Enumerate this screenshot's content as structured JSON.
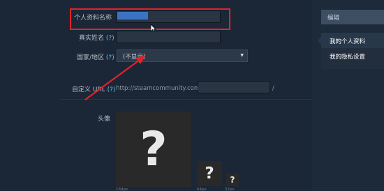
{
  "sidebar": {
    "edit_label": "编辑",
    "items": [
      {
        "label": "我的个人资料",
        "active": true
      },
      {
        "label": "我的隐私设置",
        "active": false
      }
    ]
  },
  "form": {
    "profile_name": {
      "label": "个人资料名称"
    },
    "real_name": {
      "label": "真实姓名",
      "help": "(?)"
    },
    "country": {
      "label": "国家/地区",
      "help": "(?)",
      "selected": "(不显示)"
    },
    "custom_url": {
      "label": "自定义 URL",
      "help": "(?)",
      "prefix": "http://steamcommunity.com/id/",
      "suffix": "/"
    },
    "avatar": {
      "label": "头像",
      "sizes": [
        "184px",
        "64px",
        "32px"
      ]
    }
  },
  "icons": {
    "avatar_placeholder": "?",
    "dropdown_arrow": "▼"
  },
  "colors": {
    "highlight": "#e0232a",
    "link": "#66c0f4",
    "background": "#1b2838"
  }
}
